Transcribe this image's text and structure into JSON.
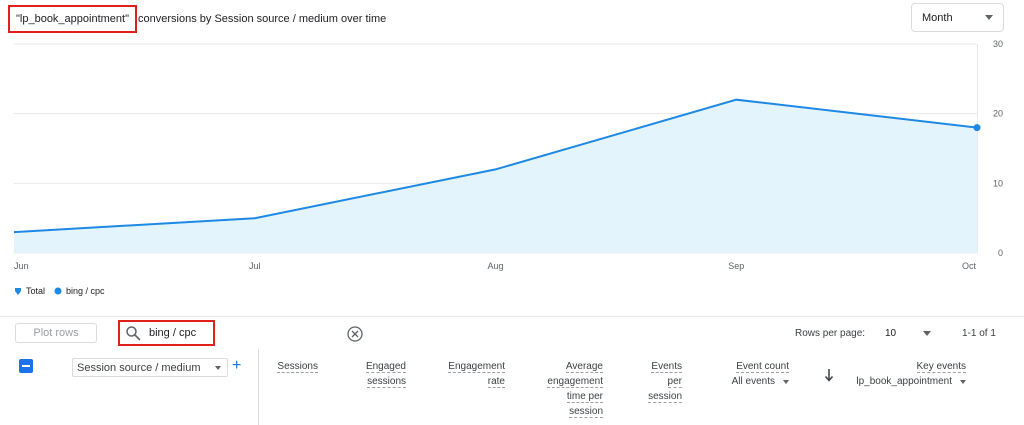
{
  "header": {
    "title_metric": "\"lp_book_appointment\"",
    "title_rest": "conversions by Session source / medium over time",
    "period": "Month"
  },
  "chart_data": {
    "type": "area",
    "x": [
      "Jun",
      "Jul",
      "Aug",
      "Sep",
      "Oct"
    ],
    "series": [
      {
        "name": "Total",
        "values": [
          3,
          5,
          12,
          22,
          18
        ]
      },
      {
        "name": "bing / cpc",
        "values": [
          3,
          5,
          12,
          22,
          18
        ]
      }
    ],
    "yticks": [
      0,
      10,
      20,
      30
    ],
    "ylim": [
      0,
      30
    ],
    "grid": true,
    "legend": "bottom-left",
    "colors": {
      "line": "#1e88e5",
      "fill": "#e3f4fc",
      "grid": "#e8eaed"
    }
  },
  "legend": {
    "items": [
      {
        "label": "Total",
        "icon": "pin-icon"
      },
      {
        "label": "bing / cpc",
        "icon": "dot-icon"
      }
    ]
  },
  "toolbar": {
    "plot_rows": "Plot rows",
    "search_value": "bing / cpc",
    "rows_per_page_label": "Rows per page:",
    "rows_per_page_value": "10",
    "pagination": "1-1 of 1"
  },
  "table": {
    "dimension": "Session source / medium",
    "add": "+",
    "columns": [
      {
        "lines": [
          "Sessions"
        ]
      },
      {
        "lines": [
          "Engaged",
          "sessions"
        ]
      },
      {
        "lines": [
          "Engagement",
          "rate"
        ]
      },
      {
        "lines": [
          "Average",
          "engagement",
          "time per",
          "session"
        ]
      },
      {
        "lines": [
          "Events",
          "per",
          "session"
        ]
      },
      {
        "lines": [
          "Event count"
        ],
        "sub": "All events"
      },
      {
        "lines": [
          "Key events"
        ],
        "sub": "lp_book_appointment"
      }
    ]
  }
}
